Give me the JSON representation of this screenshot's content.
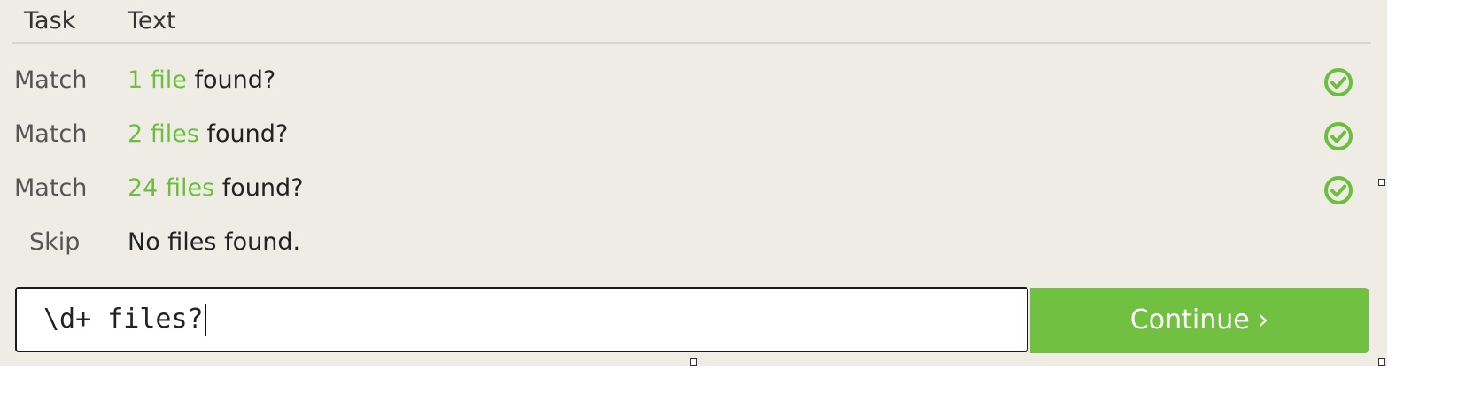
{
  "header": {
    "task_label": "Task",
    "text_label": "Text"
  },
  "rows": [
    {
      "task": "Match",
      "highlight": "1 file",
      "rest": " found?",
      "status": "check-circle-icon"
    },
    {
      "task": "Match",
      "highlight": "2 files",
      "rest": " found?",
      "status": "check-circle-icon"
    },
    {
      "task": "Match",
      "highlight": "24 files",
      "rest": " found?",
      "status": "check-circle-icon"
    },
    {
      "task": "Skip",
      "highlight": "",
      "rest": "No files found.",
      "status": ""
    }
  ],
  "input": {
    "value": "\\d+ files?"
  },
  "continue_button": {
    "label": "Continue ›"
  },
  "colors": {
    "panel": "#efece6",
    "accent_green": "#72c042",
    "highlight_green": "#6cbf3c"
  }
}
